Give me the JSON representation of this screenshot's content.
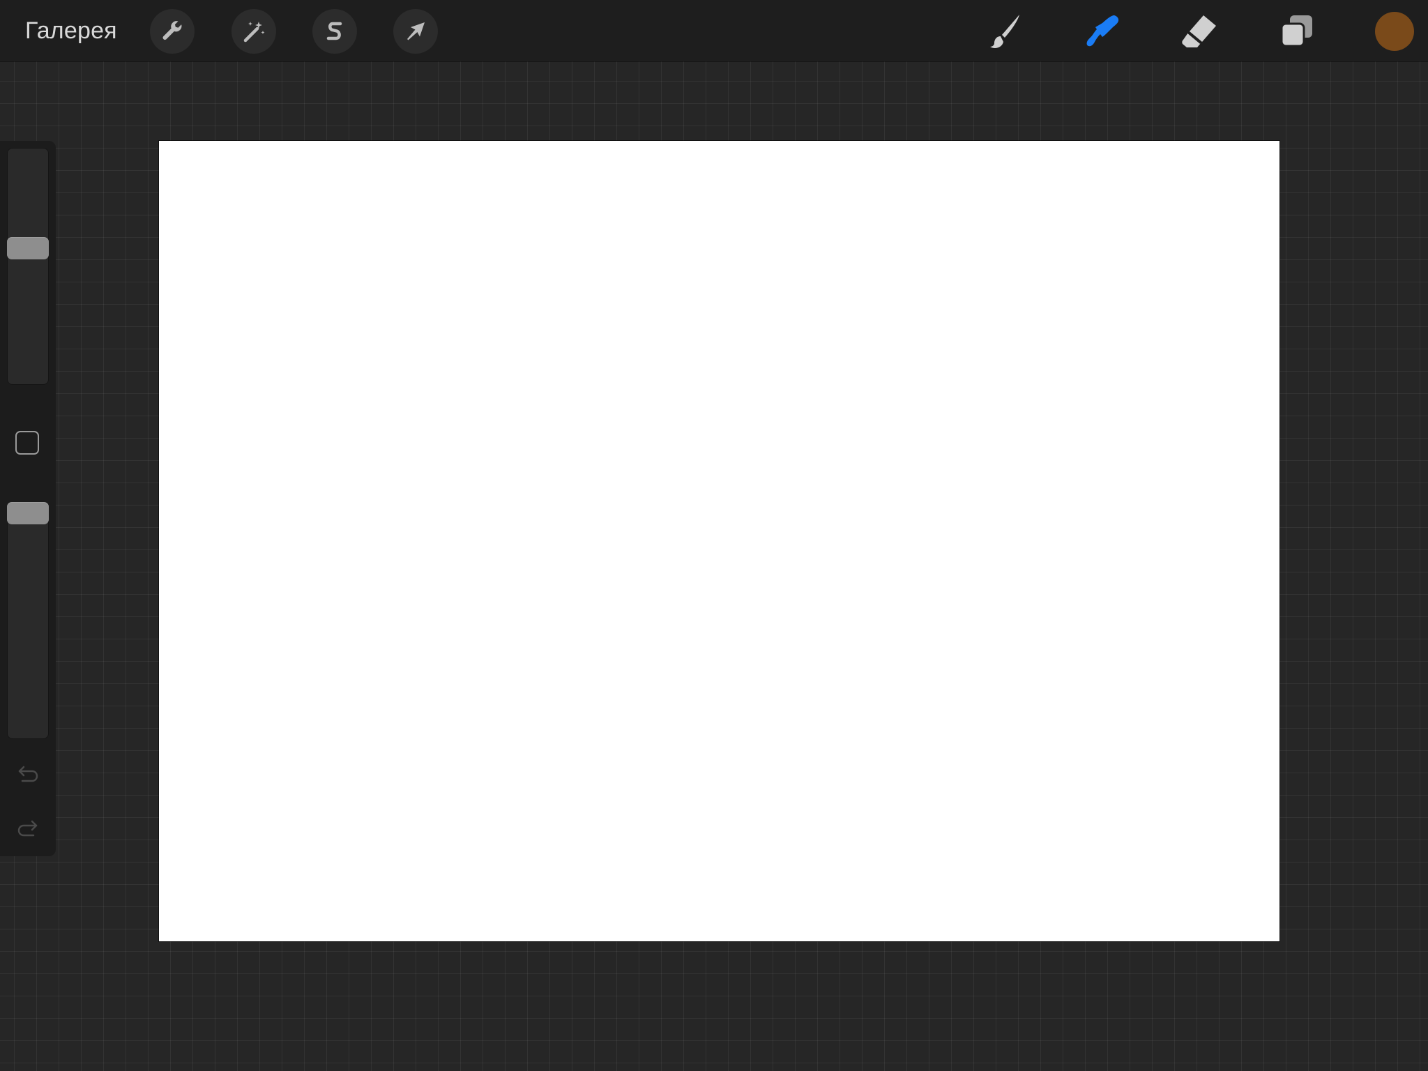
{
  "toolbar": {
    "gallery_label": "Галерея",
    "left_buttons": [
      {
        "name": "actions",
        "icon": "wrench-icon"
      },
      {
        "name": "adjustments",
        "icon": "magic-wand-icon"
      },
      {
        "name": "selection",
        "icon": "selection-s-icon"
      },
      {
        "name": "transform",
        "icon": "arrow-cursor-icon"
      }
    ],
    "right_tools": [
      {
        "name": "brush",
        "icon": "brush-icon",
        "active": false
      },
      {
        "name": "smudge",
        "icon": "smudge-icon",
        "active": true
      },
      {
        "name": "eraser",
        "icon": "eraser-icon",
        "active": false
      },
      {
        "name": "layers",
        "icon": "layers-icon",
        "active": false
      }
    ],
    "current_color": "#7a4a1a",
    "active_tool_color": "#1a7cf5"
  },
  "sidebar": {
    "brush_size_slider": {
      "position_fraction": 0.42
    },
    "modify_button": {
      "icon": "square-icon"
    },
    "opacity_slider": {
      "position_fraction": 0.0
    },
    "undo": {
      "icon": "undo-arrow-icon",
      "enabled": false
    },
    "redo": {
      "icon": "redo-arrow-icon",
      "enabled": false
    }
  },
  "canvas": {
    "background_color": "#ffffff",
    "content": "blank"
  }
}
